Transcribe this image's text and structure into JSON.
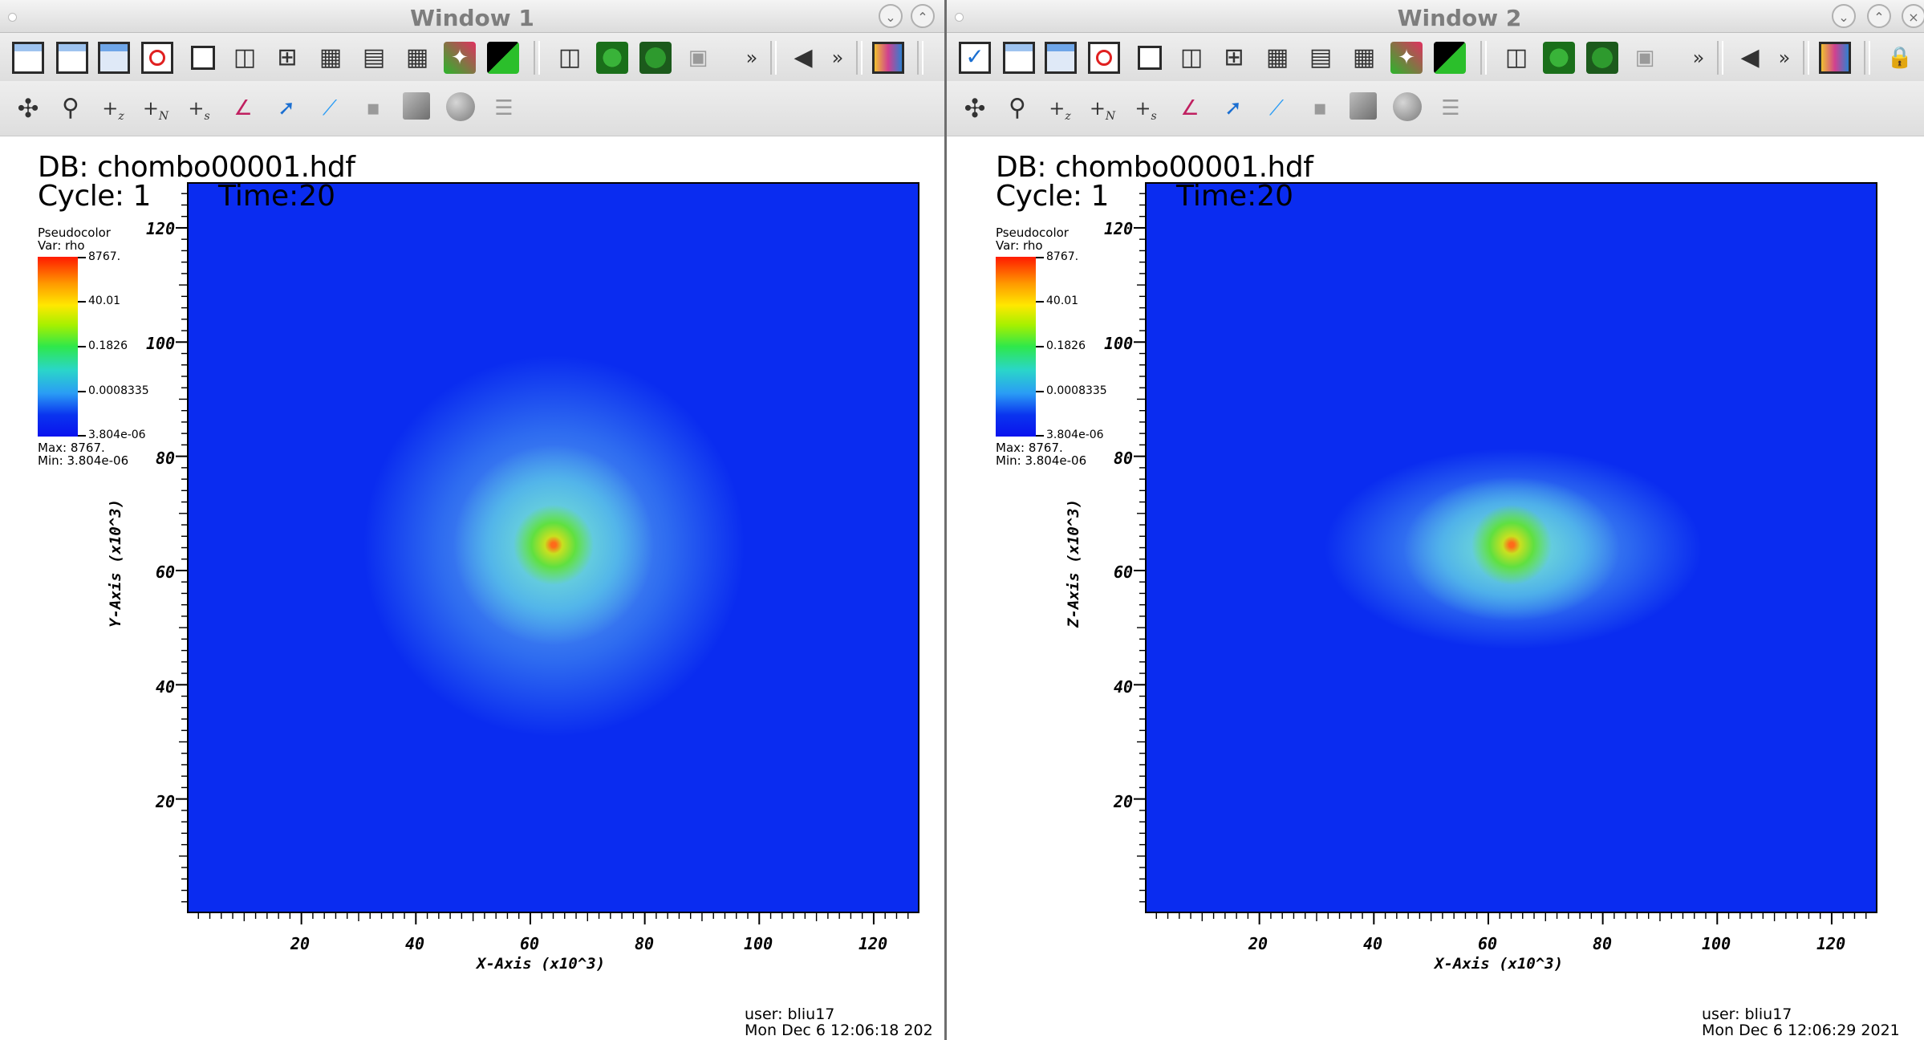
{
  "windows": [
    {
      "title": "Window 1",
      "db_label": "DB: chombo00001.hdf",
      "cycle_label": "Cycle: 1",
      "time_label": "Time:20",
      "legend": {
        "title_line1": "Pseudocolor",
        "title_line2": "Var: rho",
        "max_label": "Max: 8767.",
        "min_label": "Min: 3.804e-06"
      },
      "x_axis_label": "X-Axis  (x10^3)",
      "y_axis_label": "Y-Axis  (x10^3)",
      "user_line": "user: bliu17",
      "date_line": "Mon Dec  6 12:06:18 202",
      "density_shape": "round"
    },
    {
      "title": "Window 2",
      "db_label": "DB: chombo00001.hdf",
      "cycle_label": "Cycle: 1",
      "time_label": "Time:20",
      "legend": {
        "title_line1": "Pseudocolor",
        "title_line2": "Var: rho",
        "max_label": "Max: 8767.",
        "min_label": "Min: 3.804e-06"
      },
      "x_axis_label": "X-Axis  (x10^3)",
      "y_axis_label": "Z-Axis  (x10^3)",
      "user_line": "user: bliu17",
      "date_line": "Mon Dec  6 12:06:29 2021",
      "density_shape": "elongated"
    }
  ],
  "colorbar_labels": [
    "8767.",
    "40.01",
    "0.1826",
    "0.0008335",
    "3.804e-06"
  ],
  "tick_labels": [
    "20",
    "40",
    "60",
    "80",
    "100",
    "120"
  ],
  "toolbar_icons_row1": [
    "new-window-icon",
    "clear-window-icon",
    "copy-window-icon",
    "delete-window-icon",
    "layout-1x1-icon",
    "layout-1x2-icon",
    "layout-2x2-icon",
    "layout-2x3-icon",
    "layout-2x4-icon",
    "layout-3x3-icon",
    "lock-view-icon",
    "spectrum-icon",
    "perspective-icon",
    "recenter-icon",
    "undo-view-icon",
    "camera-icon",
    "more-icon",
    "animation-back-icon",
    "more-icon",
    "invert-background-icon"
  ],
  "toolbar_icons_row2": [
    "navigate-icon",
    "zoom-icon",
    "plus-z-icon",
    "plus-n-icon",
    "plus-s-icon",
    "lineout-icon",
    "pick-icon",
    "line-icon",
    "plane-icon",
    "box-icon",
    "sphere-icon",
    "sliders-icon"
  ],
  "colors": {
    "field_background": "#0a2cf0",
    "titlebar_text": "#7d7d7d"
  },
  "chart_data": [
    {
      "type": "heatmap",
      "title": "",
      "xlabel": "X-Axis (x10^3)",
      "ylabel": "Y-Axis (x10^3)",
      "xlim": [
        0,
        128
      ],
      "ylim": [
        0,
        128
      ],
      "variable": "rho",
      "color_scale": "log",
      "colorbar": {
        "ticks": [
          8767,
          40.01,
          0.1826,
          0.0008335,
          3.804e-06
        ],
        "max": 8767,
        "min": 3.804e-06
      },
      "peak_center": [
        64,
        64
      ],
      "grid": false
    },
    {
      "type": "heatmap",
      "title": "",
      "xlabel": "X-Axis (x10^3)",
      "ylabel": "Z-Axis (x10^3)",
      "xlim": [
        0,
        128
      ],
      "ylim": [
        0,
        128
      ],
      "variable": "rho",
      "color_scale": "log",
      "colorbar": {
        "ticks": [
          8767,
          40.01,
          0.1826,
          0.0008335,
          3.804e-06
        ],
        "max": 8767,
        "min": 3.804e-06
      },
      "peak_center": [
        64,
        64
      ],
      "grid": false
    }
  ]
}
